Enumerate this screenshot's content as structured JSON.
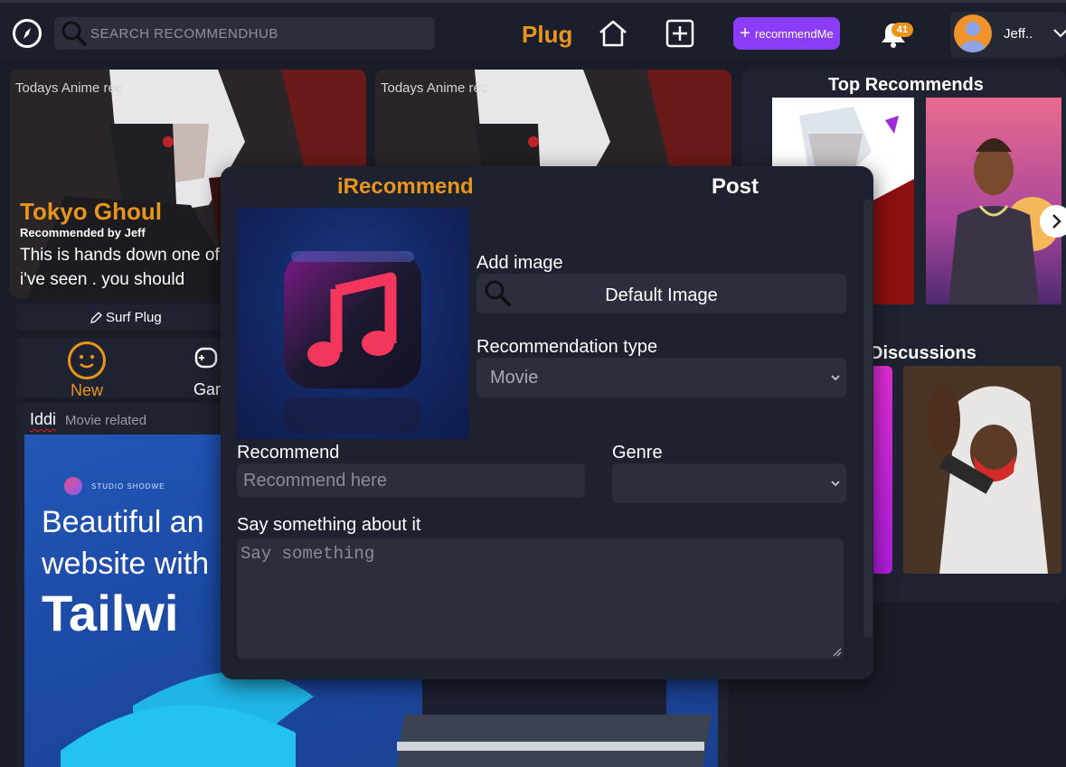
{
  "header": {
    "search_placeholder": "SEARCH RECOMMENDHUB",
    "brand": "Plug",
    "recommend_me_label": "recommendMe",
    "notifications_count": "41",
    "user_name": "Jeff.."
  },
  "anime_cards": [
    {
      "small_label": "Todays Anime rec",
      "title": "Tokyo Ghoul",
      "by": "Recommended by Jeff",
      "desc": "This is hands down one of my best anime's i've seen . you should"
    },
    {
      "small_label": "Todays Anime rec"
    }
  ],
  "surf_plug_label": "Surf Plug",
  "tabs": {
    "new_label": "New",
    "games_label": "Gam"
  },
  "post": {
    "user": "Iddi",
    "tag": "Movie related",
    "studio": "STUDIO SHODWE",
    "hero_line1": "Beautiful an",
    "hero_line2": "website with",
    "hero_line3": "Tailwi"
  },
  "sidebar": {
    "top_title": "Top Recommends",
    "discussions_title": "Discussions"
  },
  "modal": {
    "tab_irecommend": "iRecommend",
    "tab_post": "Post",
    "add_image_label": "Add image",
    "default_image_label": "Default Image",
    "recommendation_type_label": "Recommendation type",
    "recommendation_type_value": "Movie",
    "recommend_label": "Recommend",
    "recommend_placeholder": "Recommend here",
    "genre_label": "Genre",
    "say_label": "Say something about it",
    "say_placeholder": "Say something"
  },
  "colors": {
    "accent_orange": "#e8951c",
    "accent_purple": "#8b3cf7",
    "background": "#1a1d28",
    "panel": "#1f2230",
    "field": "#2b2f3d"
  },
  "icons": [
    "compass-icon",
    "search-icon",
    "home-icon",
    "add-square-icon",
    "plus-icon",
    "bell-icon",
    "chevron-down-icon",
    "pencil-icon",
    "smile-icon",
    "gamepad-icon",
    "chevron-right-icon",
    "music-note-icon"
  ]
}
